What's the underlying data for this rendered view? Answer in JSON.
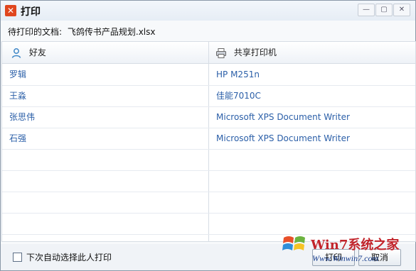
{
  "window": {
    "title": "打印",
    "app_icon_glyph": "✕",
    "controls": {
      "minimize": "—",
      "maximize": "▢",
      "close": "✕"
    }
  },
  "document": {
    "label": "待打印的文档:",
    "filename": "飞鸽传书产品规划.xlsx"
  },
  "table": {
    "columns": [
      {
        "label": "好友",
        "icon": "user-icon"
      },
      {
        "label": "共享打印机",
        "icon": "printer-icon"
      }
    ],
    "rows": [
      {
        "friend": "罗辑",
        "printer": "HP M251n"
      },
      {
        "friend": "王淼",
        "printer": "佳能7010C"
      },
      {
        "friend": "张思伟",
        "printer": "Microsoft XPS Document Writer"
      },
      {
        "friend": "石强",
        "printer": "Microsoft XPS Document Writer"
      }
    ]
  },
  "footer": {
    "auto_select_label": "下次自动选择此人打印",
    "print_button": "打印",
    "cancel_button": "取消"
  },
  "watermark": {
    "brand": "Win7系统之家",
    "url": "Www.Winwin7.com"
  },
  "colors": {
    "link_text": "#2b5fa8",
    "app_icon_bg": "#e0461e",
    "watermark_red": "#c2242b"
  }
}
